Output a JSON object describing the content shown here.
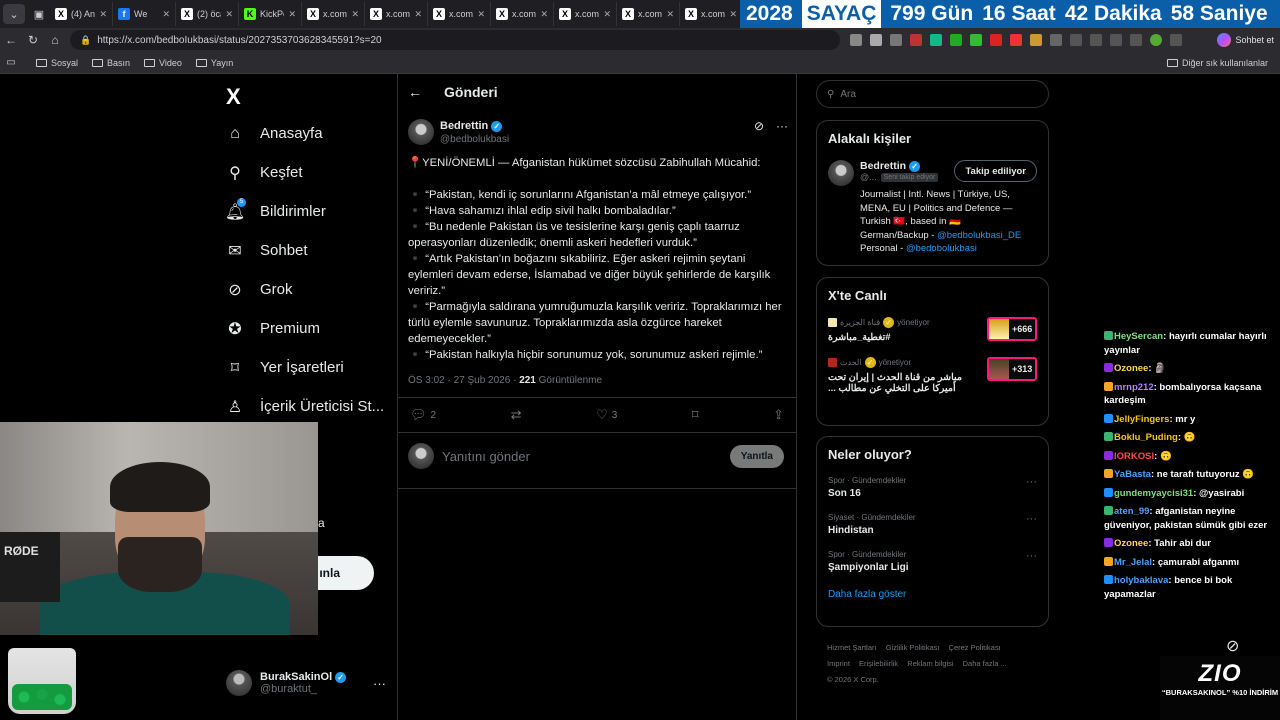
{
  "browser": {
    "tabs": [
      {
        "icon": "X",
        "title": "(4) Ana"
      },
      {
        "icon": "f",
        "title": "We"
      },
      {
        "icon": "X",
        "title": "(2) öca"
      },
      {
        "icon": "K",
        "title": "KickPe"
      },
      {
        "icon": "X",
        "title": "x.com/"
      },
      {
        "icon": "X",
        "title": "x.com/"
      },
      {
        "icon": "X",
        "title": "x.com/"
      },
      {
        "icon": "X",
        "title": "x.com/"
      },
      {
        "icon": "X",
        "title": "x.com/"
      },
      {
        "icon": "X",
        "title": "x.com/"
      },
      {
        "icon": "X",
        "title": "x.com/"
      }
    ],
    "url": "https://x.com/bedboIukbasi/status/2027353703628345591?s=20",
    "chat_button": "Sohbet et",
    "bookmarks": [
      "Sosyal",
      "Basın",
      "Video",
      "Yayın"
    ],
    "other_bookmarks": "Diğer sık kullanılanlar"
  },
  "countdown": {
    "year": "2028",
    "label": "SAYAÇ",
    "days": "799 Gün",
    "hours": "16 Saat",
    "minutes": "42 Dakika",
    "seconds": "58 Saniye"
  },
  "sidebar": {
    "logo": "X",
    "items": [
      {
        "label": "Anasayfa",
        "icon": "home-icon"
      },
      {
        "label": "Keşfet",
        "icon": "search-icon"
      },
      {
        "label": "Bildirimler",
        "icon": "bell-icon",
        "badge": "5"
      },
      {
        "label": "Sohbet",
        "icon": "mail-icon"
      },
      {
        "label": "Grok",
        "icon": "grok-icon"
      },
      {
        "label": "Premium",
        "icon": "premium-icon"
      },
      {
        "label": "Yer İşaretleri",
        "icon": "bookmark-icon"
      },
      {
        "label": "İçerik Üreticisi St...",
        "icon": "creator-icon"
      }
    ],
    "partial_label": "a",
    "post_button_partial": "ınla",
    "account": {
      "name": "BurakSakinOl",
      "handle": "@buraktut_"
    }
  },
  "post": {
    "heading": "Gönderi",
    "author": {
      "name": "Bedrettin",
      "handle": "@bedbolukbasi"
    },
    "lead": "📍YENİ/ÖNEMLİ — Afganistan hükümet sözcüsü Zabihullah Mücahid:",
    "quotes": [
      "▪️ “Pakistan, kendi iç sorunlarını Afganistan’a mâl etmeye çalışıyor.”",
      "▪️ “Hava sahamızı ihlal edip sivil halkı bombaladılar.”",
      "▪️ “Bu nedenle Pakistan üs ve tesislerine karşı geniş çaplı taarruz operasyonları düzenledik; önemli askeri hedefleri vurduk.”",
      "▪️ “Artık Pakistan’ın boğazını sıkabiliriz. Eğer askeri rejimin şeytani eylemleri devam ederse, İslamabad ve diğer büyük şehirlerde de karşılık veririz.”",
      "▪️ “Parmağıyla saldırana yumruğumuzla karşılık veririz. Topraklarımızı her türlü eylemle savunuruz. Topraklarımızda asla özgürce hareket edemeyecekler.”",
      "▪️ “Pakistan halkıyla hiçbir sorunumuz yok, sorunumuz askeri rejimle.”"
    ],
    "time": "ÖS 3:02 · 27 Şub 2026 · ",
    "views": "221",
    "views_label": " Görüntülenme",
    "replies": "2",
    "likes": "3",
    "reply_placeholder": "Yanıtını gönder",
    "reply_button": "Yanıtla"
  },
  "right": {
    "search_placeholder": "Ara",
    "related_title": "Alakalı kişiler",
    "person": {
      "name": "Bedrettin",
      "handle": "@...",
      "follows_you": "Seni takip ediyor",
      "follow_button": "Takip ediliyor",
      "bio_1": "Journalist | Intl. News | Türkiye, US, MENA, EU | Politics and Defence — Turkish 🇹🇷, based in 🇩🇪",
      "bio_2": "German/Backup - ",
      "bio_link_1": "@bedbolukbasi_DE",
      "bio_3": "Personal - ",
      "bio_link_2": "@bedobolukbasi"
    },
    "live_title": "X'te Canlı",
    "live": [
      {
        "source": "قناة الجزيرة",
        "role": "yönetiyor",
        "title": "#تغطية_مباشرة",
        "count": "+666"
      },
      {
        "source": "الحدث",
        "role": "yönetiyor",
        "title": "مباشر من قناة الحدث | إيران تحت أميركا على التخلي عن مطالب ...",
        "count": "+313"
      }
    ],
    "trends_title": "Neler oluyor?",
    "trends": [
      {
        "category": "Spor · Gündemdekiler",
        "name": "Son 16"
      },
      {
        "category": "Siyaset · Gündemdekiler",
        "name": "Hindistan"
      },
      {
        "category": "Spor · Gündemdekiler",
        "name": "Şampiyonlar Ligi"
      }
    ],
    "show_more": "Daha fazla göster",
    "footer": [
      "Hizmet Şartları",
      "Gizlilik Politikası",
      "Çerez Politikası",
      "Imprint",
      "Erişilebilirlik",
      "Reklam bilgisi",
      "Daha fazla ...",
      "© 2026 X Corp."
    ]
  },
  "stream": {
    "mic_brand": "RØDE",
    "chat": [
      {
        "user": "HeySercan",
        "text": "hayırlı cumalar hayırlı yayınlar",
        "color": "g"
      },
      {
        "user": "Ozonee",
        "text": "🗿",
        "color": "y"
      },
      {
        "user": "mrnp212",
        "text": "bombalıyorsa kaçsana kardeşim",
        "color": "p"
      },
      {
        "user": "JellyFingers",
        "text": "mr y",
        "color": "o"
      },
      {
        "user": "Boklu_Puding",
        "text": "🙃",
        "color": "o"
      },
      {
        "user": "lORKOSl",
        "text": "🙃",
        "color": "r"
      },
      {
        "user": "YaBasta",
        "text": "ne tarafı tutuyoruz 🙃",
        "color": "b"
      },
      {
        "user": "gundemyaycisi31",
        "text": "@yasirabi",
        "color": "g"
      },
      {
        "user": "aten_99",
        "text": "afganistan neyine güveniyor, pakistan sümük gibi ezer",
        "color": "b"
      },
      {
        "user": "Ozonee",
        "text": "Tahir abi dur",
        "color": "y"
      },
      {
        "user": "Mr_Jelal",
        "text": "çamurabi afganmı",
        "color": "b"
      },
      {
        "user": "holybaklava",
        "text": "bence bi bok yapamazlar",
        "color": "b"
      }
    ],
    "promo_brand": "ZIO",
    "promo_code": "“BURAKSAKINOL” %10 İNDİRİM"
  }
}
